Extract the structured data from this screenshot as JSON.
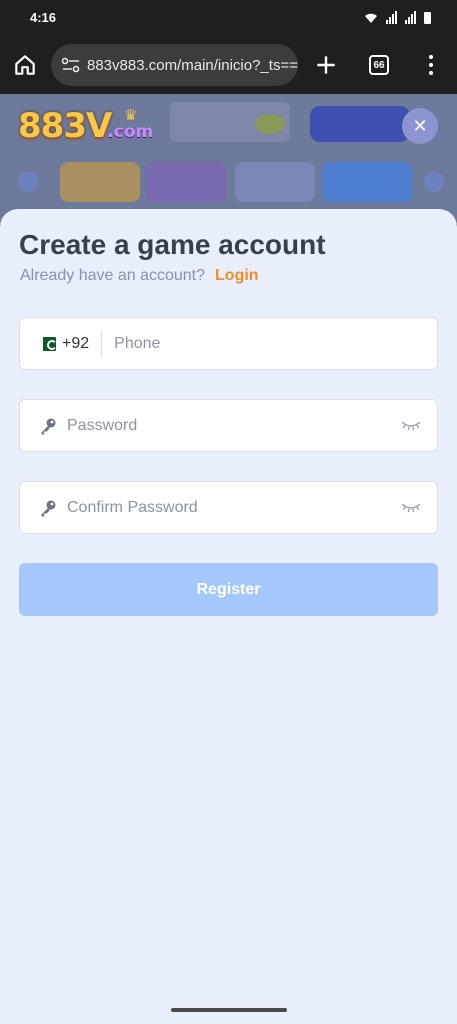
{
  "status_bar": {
    "time": "4:16"
  },
  "browser": {
    "url": "883v883.com/main/inicio?_ts==",
    "tab_count": "66",
    "icons": [
      "home-icon",
      "site-settings-icon",
      "plus-icon",
      "tabs-icon",
      "more-icon"
    ]
  },
  "logo": {
    "main": "883V",
    "sub": ".com",
    "crown": "♛"
  },
  "close_icon": "✕",
  "form": {
    "title": "Create a game account",
    "subtitle": "Already have an account?",
    "login_label": "Login",
    "phone": {
      "country_code": "+92",
      "placeholder": "Phone"
    },
    "password": {
      "placeholder": "Password"
    },
    "confirm_password": {
      "placeholder": "Confirm Password"
    },
    "register_label": "Register"
  },
  "colors": {
    "sheet_bg": "#e9effc",
    "accent_orange": "#f28c1f",
    "register_disabled": "#a4c8fb",
    "title_text": "#3a3f4e"
  }
}
